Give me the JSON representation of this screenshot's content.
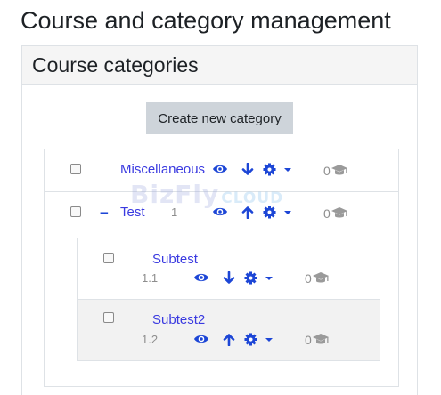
{
  "page": {
    "title": "Course and category management"
  },
  "panel": {
    "heading": "Course categories",
    "create_label": "Create new category"
  },
  "watermark": {
    "brand": "BizFly",
    "cloud": "CLOUD"
  },
  "categories": [
    {
      "name": "Miscellaneous",
      "idnumber": "",
      "count": "0"
    },
    {
      "name": "Test",
      "idnumber": "1",
      "count": "0",
      "expand_symbol": "−"
    },
    {
      "name": "Subtest",
      "idnumber": "1.1",
      "count": "0"
    },
    {
      "name": "Subtest2",
      "idnumber": "1.2",
      "count": "0"
    }
  ],
  "colors": {
    "accent": "#1d46d6",
    "link": "#3a3ae0",
    "muted": "#8e8e8e",
    "button": "#ced4da"
  }
}
